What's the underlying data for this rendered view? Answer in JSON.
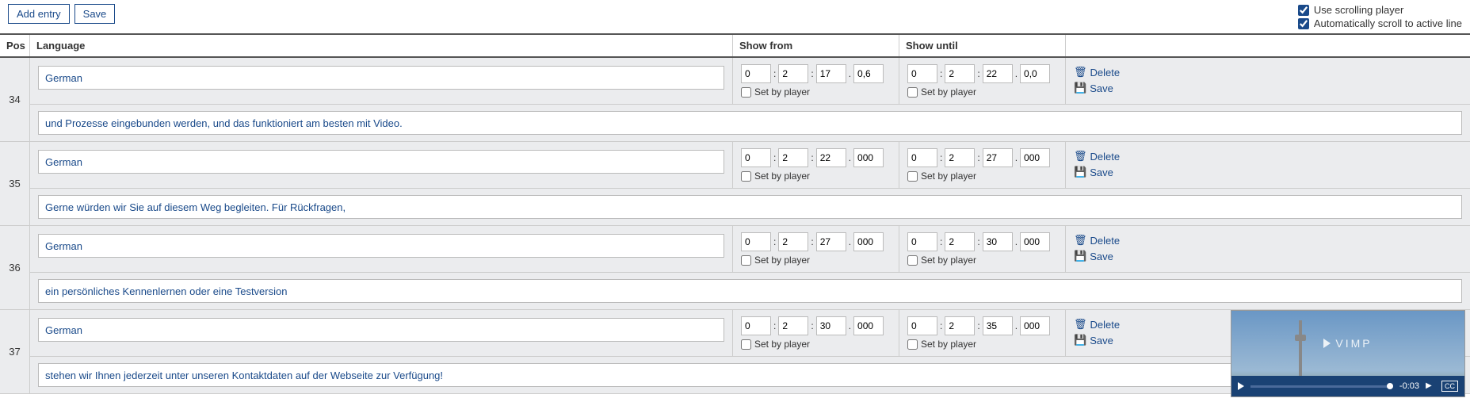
{
  "toolbar": {
    "add_entry": "Add entry",
    "save": "Save",
    "use_scrolling_player": "Use scrolling player",
    "auto_scroll": "Automatically scroll to active line"
  },
  "headers": {
    "pos": "Pos",
    "language": "Language",
    "show_from": "Show from",
    "show_until": "Show until"
  },
  "labels": {
    "set_by_player": "Set by player",
    "delete": "Delete",
    "save_entry": "Save"
  },
  "entries": [
    {
      "pos": "34",
      "language": "German",
      "from_h": "0",
      "from_m": "2",
      "from_s": "17",
      "from_ms": "0,6",
      "until_h": "0",
      "until_m": "2",
      "until_s": "22",
      "until_ms": "0,0",
      "text": "und Prozesse eingebunden werden, und das funktioniert am besten mit Video."
    },
    {
      "pos": "35",
      "language": "German",
      "from_h": "0",
      "from_m": "2",
      "from_s": "22",
      "from_ms": "000",
      "until_h": "0",
      "until_m": "2",
      "until_s": "27",
      "until_ms": "000",
      "text": "Gerne würden wir Sie auf diesem Weg begleiten. Für Rückfragen,"
    },
    {
      "pos": "36",
      "language": "German",
      "from_h": "0",
      "from_m": "2",
      "from_s": "27",
      "from_ms": "000",
      "until_h": "0",
      "until_m": "2",
      "until_s": "30",
      "until_ms": "000",
      "text": "ein persönliches Kennenlernen oder eine Testversion"
    },
    {
      "pos": "37",
      "language": "German",
      "from_h": "0",
      "from_m": "2",
      "from_s": "30",
      "from_ms": "000",
      "until_h": "0",
      "until_m": "2",
      "until_s": "35",
      "until_ms": "000",
      "text": "stehen wir Ihnen jederzeit unter unseren Kontaktdaten auf der Webseite zur Verfügung!"
    }
  ],
  "player": {
    "logo": "VIMP",
    "time": "-0:03",
    "cc": "CC"
  }
}
